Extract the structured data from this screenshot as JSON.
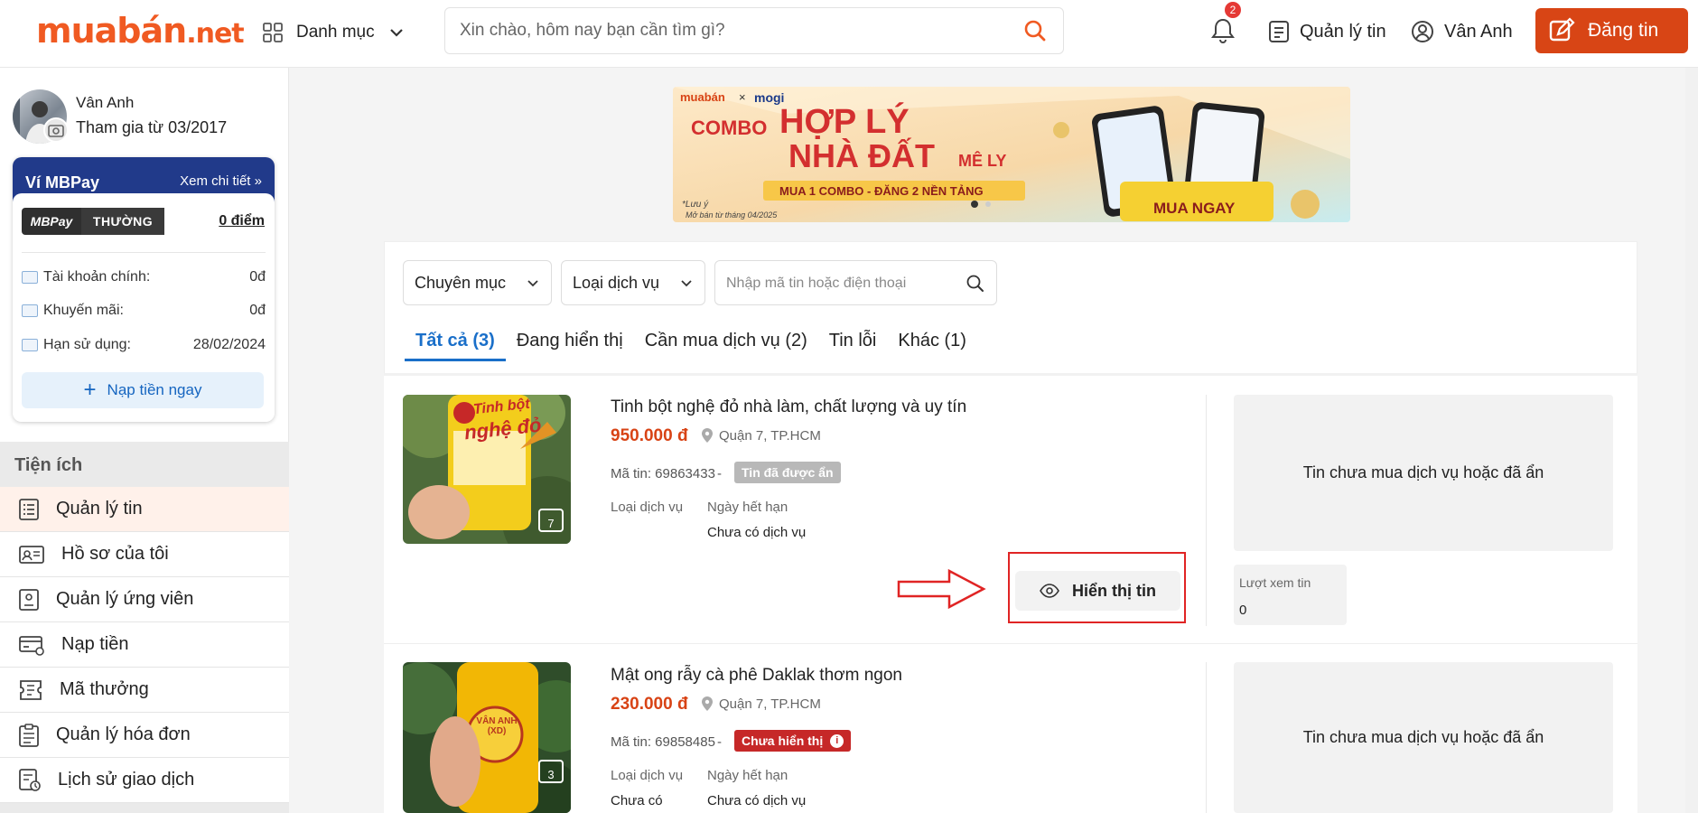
{
  "header": {
    "logo_main": "muabán",
    "logo_suffix": ".net",
    "category_label": "Danh mục",
    "search_placeholder": "Xin chào, hôm nay bạn cần tìm gì?",
    "notification_count": "2",
    "manage_label": "Quản lý tin",
    "user_label": "Vân Anh",
    "post_label": "Đăng tin"
  },
  "profile": {
    "name": "Vân Anh",
    "joined": "Tham gia từ 03/2017"
  },
  "wallet": {
    "title": "Ví MBPay",
    "detail_link": "Xem chi tiết",
    "brand_left": "MBPay",
    "tier": "THƯỜNG",
    "points": "0 điểm",
    "rows": [
      {
        "label": "Tài khoản chính:",
        "value": "0đ"
      },
      {
        "label": "Khuyến mãi:",
        "value": "0đ"
      },
      {
        "label": "Hạn sử dụng:",
        "value": "28/02/2024"
      }
    ],
    "topup_label": "Nạp tiền ngay"
  },
  "sidebar": {
    "section_title": "Tiện ích",
    "items": [
      {
        "label": "Quản lý tin",
        "icon": "list-icon"
      },
      {
        "label": "Hồ sơ của tôi",
        "icon": "id-card-icon"
      },
      {
        "label": "Quản lý ứng viên",
        "icon": "candidate-icon"
      },
      {
        "label": "Nạp tiền",
        "icon": "card-icon"
      },
      {
        "label": "Mã thưởng",
        "icon": "voucher-icon"
      },
      {
        "label": "Quản lý hóa đơn",
        "icon": "clipboard-icon"
      },
      {
        "label": "Lịch sử giao dịch",
        "icon": "history-icon"
      }
    ]
  },
  "banner": {
    "brand_left": "muabán",
    "brand_x": "×",
    "brand_right": "mogi",
    "line1a": "COMBO",
    "line1b": "HỢP LÝ",
    "line2a": "NHÀ ĐẤT",
    "line2b": "MÊ LY",
    "ribbon": "MUA 1 COMBO - ĐĂNG 2 NỀN TẢNG",
    "note1": "*Lưu ý",
    "note2": "Mở bán từ tháng 04/2025",
    "cta": "MUA NGAY"
  },
  "filters": {
    "category": "Chuyên mục",
    "service_type": "Loại dịch vụ",
    "search_placeholder": "Nhập mã tin hoặc điện thoại"
  },
  "tabs": [
    {
      "label": "Tất cả (3)",
      "active": true
    },
    {
      "label": "Đang hiển thị",
      "active": false
    },
    {
      "label": "Cần mua dịch vụ (2)",
      "active": false
    },
    {
      "label": "Tin lỗi",
      "active": false
    },
    {
      "label": "Khác (1)",
      "active": false
    }
  ],
  "listings": [
    {
      "title": "Tinh bột nghệ đỏ nhà làm, chất lượng và uy tín",
      "price": "950.000 đ",
      "location": "Quận 7, TP.HCM",
      "code": "Mã tin: 69863433",
      "dash": "-",
      "status": "Tin đã được ẩn",
      "status_color": "#b8b8b8",
      "service_label": "Loại dịch vụ",
      "service_value": "",
      "expiry_label": "Ngày hết hạn",
      "expiry_value": "Chưa có dịch vụ",
      "photo_count": "7",
      "product_label_1": "Tinh bột",
      "product_label_2": "nghệ đỏ",
      "notice": "Tin chưa mua dịch vụ hoặc đã ẩn",
      "views_label": "Lượt xem tin",
      "views_value": "0",
      "action_label": "Hiển thị tin"
    },
    {
      "title": "Mật ong rẫy cà phê Daklak thơm ngon",
      "price": "230.000 đ",
      "location": "Quận 7, TP.HCM",
      "code": "Mã tin: 69858485",
      "dash": "-",
      "status": "Chưa hiển thị",
      "status_color": "#c62828",
      "service_label": "Loại dịch vụ",
      "service_value": "Chưa có",
      "expiry_label": "Ngày hết hạn",
      "expiry_value": "Chưa có dịch vụ",
      "photo_count": "3",
      "product_label_1": "VÂN ANH (XD)",
      "notice": "Tin chưa mua dịch vụ hoặc đã ẩn"
    }
  ]
}
